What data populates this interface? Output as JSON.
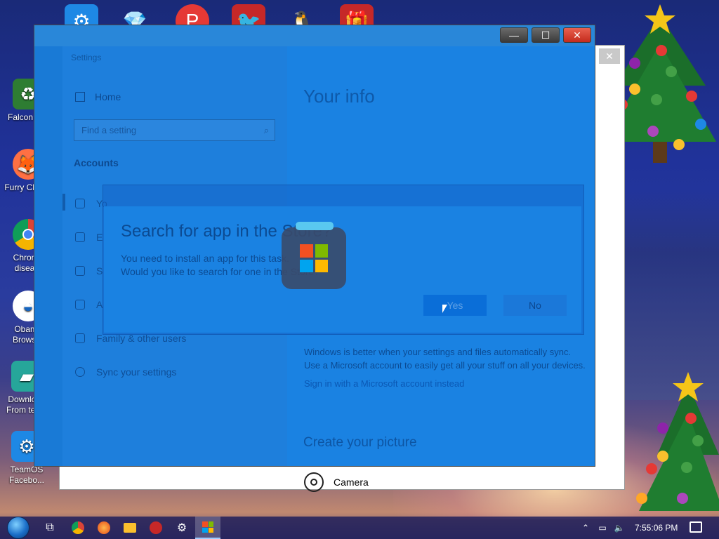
{
  "desktop": {
    "top_icons": [
      {
        "label": "Settings",
        "icon": "settings-icon",
        "color": "#1e88e5"
      },
      {
        "label": "",
        "icon": "gem-icon",
        "color": "#29b6f6"
      },
      {
        "label": "",
        "icon": "app-red-icon",
        "color": "#e53935"
      },
      {
        "label": "",
        "icon": "angry-bird-icon",
        "color": "#d32f2f"
      },
      {
        "label": "",
        "icon": "bird-icon",
        "color": "#e57373"
      },
      {
        "label": "",
        "icon": "gift-icon",
        "color": "#c62828"
      }
    ],
    "left_icons": [
      {
        "label": "Falcon C...",
        "icon": "recycle-icon",
        "color": "#2e7d32"
      },
      {
        "label": "Furry Chicks",
        "icon": "firefox-icon",
        "color": "#ff7043"
      },
      {
        "label": "Chrome disea...",
        "icon": "chrome-icon",
        "color": "#43a047"
      },
      {
        "label": "Obama Browser",
        "icon": "obama-icon",
        "color": "#1565c0"
      },
      {
        "label": "Download From tea...",
        "icon": "download-icon",
        "color": "#26a69a"
      },
      {
        "label": "TeamOS Facebo...",
        "icon": "gear-icon",
        "color": "#1e88e5"
      }
    ]
  },
  "settings_window": {
    "title": "Settings",
    "home_label": "Home",
    "search_placeholder": "Find a setting",
    "section_heading": "Accounts",
    "nav_items": [
      {
        "label": "Yo",
        "icon": "person-card-icon"
      },
      {
        "label": "E",
        "icon": "mail-icon"
      },
      {
        "label": "S",
        "icon": "key-icon"
      },
      {
        "label": "A",
        "icon": "briefcase-icon"
      },
      {
        "label": "Family & other users",
        "icon": "family-icon"
      },
      {
        "label": "Sync your settings",
        "icon": "sync-icon"
      }
    ],
    "page_title": "Your info",
    "sync_line1": "Windows is better when your settings and files automatically sync.",
    "sync_line2": "Use a Microsoft account to easily get all your stuff on all your devices.",
    "ms_link": "Sign in with a Microsoft account instead",
    "create_picture": "Create your picture",
    "camera_label": "Camera"
  },
  "dialog": {
    "title": "Search for app in the Store?",
    "message_line1": "You need to install an app for this task.",
    "message_line2": "Would you like to search for one in the Store?",
    "yes_label": "Yes",
    "no_label": "No"
  },
  "taskbar": {
    "items": [
      "task-view-icon",
      "chrome-icon",
      "firefox-icon",
      "file-explorer-icon",
      "game-icon",
      "settings-icon",
      "store-icon"
    ],
    "clock": "7:55:06 PM"
  },
  "colors": {
    "overlay_blue": "#1a82e2",
    "close_red": "#c42b1c",
    "store_red": "#f25022",
    "store_green": "#7fba00",
    "store_blue": "#00a4ef",
    "store_yellow": "#ffb900"
  }
}
